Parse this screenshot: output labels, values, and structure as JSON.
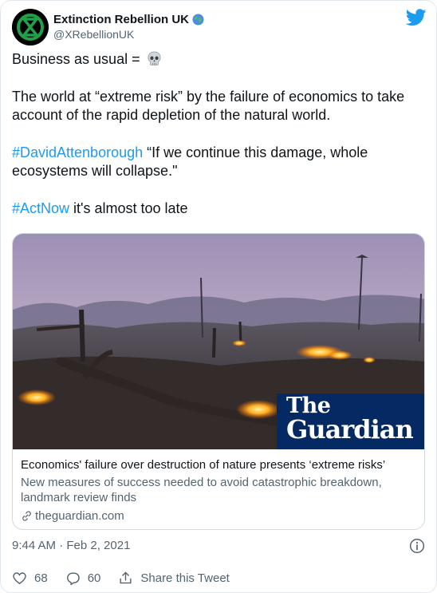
{
  "author": {
    "display_name": "Extinction Rebellion UK",
    "handle": "@XRebellionUK",
    "avatar_icon": "extinction-symbol-icon",
    "badge_icon": "globe-icon"
  },
  "tweet": {
    "line1_text": "Business as usual =",
    "line1_emoji": "skull-icon",
    "line2_text": "The world at “extreme risk” by the failure of economics to take account of the rapid depletion of the natural world.",
    "line3_hashtag": "#DavidAttenborough",
    "line3_text": " “If we continue this damage, whole ecosystems will collapse.\"",
    "line4_hashtag": "#ActNow",
    "line4_text": " it's almost too late"
  },
  "link_card": {
    "image_alt": "burning deforested land",
    "brand_the": "The",
    "brand_name": "Guardian",
    "title": "Economics' failure over destruction of nature presents ‘extreme risks’",
    "description": "New measures of success needed to avoid catastrophic breakdown, landmark review finds",
    "domain": "theguardian.com"
  },
  "meta": {
    "timestamp": "9:44 AM · Feb 2, 2021"
  },
  "actions": {
    "like_count": "68",
    "reply_count": "60",
    "share_label": "Share this Tweet"
  },
  "colors": {
    "accent": "#1d9bf0",
    "guardian_blue": "#052962",
    "avatar_green": "#21a04a"
  }
}
